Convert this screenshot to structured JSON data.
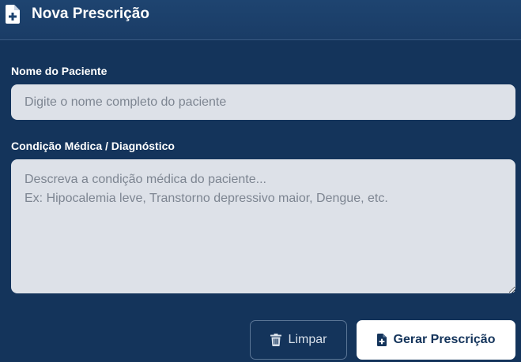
{
  "header": {
    "title": "Nova Prescrição",
    "icon": "file-medical-icon"
  },
  "form": {
    "patient_name": {
      "label": "Nome do Paciente",
      "placeholder": "Digite o nome completo do paciente",
      "value": ""
    },
    "condition": {
      "label": "Condição Médica / Diagnóstico",
      "placeholder": "Descreva a condição médica do paciente...\nEx: Hipocalemia leve, Transtorno depressivo maior, Dengue, etc.",
      "value": ""
    }
  },
  "actions": {
    "clear_label": "Limpar",
    "clear_icon": "trash-icon",
    "generate_label": "Gerar Prescrição",
    "generate_icon": "file-medical-icon"
  },
  "colors": {
    "background": "#14345b",
    "header": "#1e4470",
    "field": "#dde1e8",
    "primary_button": "#ffffff"
  }
}
